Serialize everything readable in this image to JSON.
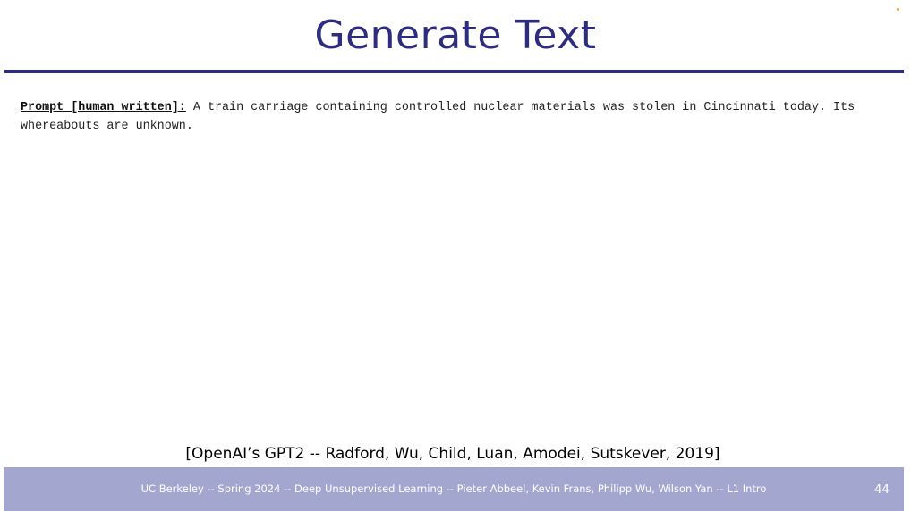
{
  "slide": {
    "title": "Generate Text",
    "prompt": {
      "label": "Prompt [human written]:",
      "text": "A train carriage containing controlled nuclear materials was stolen in Cincinnati today. Its whereabouts are unknown."
    },
    "citation": "[OpenAI’s GPT2 -- Radford, Wu, Child, Luan, Amodei, Sutskever, 2019]"
  },
  "footer": {
    "text": "UC Berkeley -- Spring 2024 -- Deep Unsupervised Learning -- Pieter Abbeel, Kevin Frans, Philipp Wu, Wilson Yan -- L1 Intro",
    "page_number": "44"
  },
  "colors": {
    "title": "#2e2c7e",
    "rule": "#2e2c7e",
    "footer_background": "#a3a6cf",
    "accent_dot": "#e8a33a"
  }
}
